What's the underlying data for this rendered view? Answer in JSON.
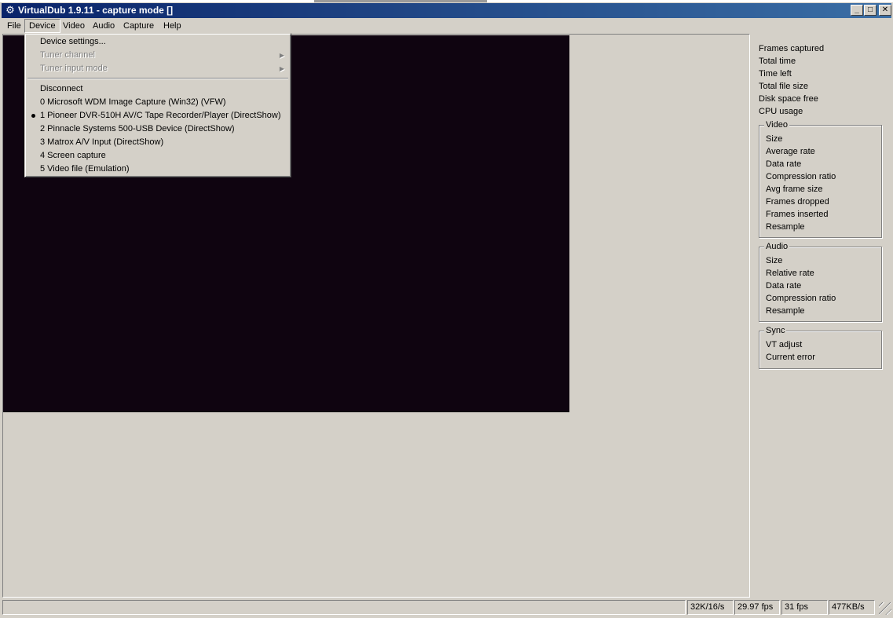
{
  "window": {
    "title": "VirtualDub 1.9.11 - capture mode []",
    "minimize_glyph": "_",
    "maximize_glyph": "□",
    "close_glyph": "✕"
  },
  "menubar": {
    "items": [
      {
        "label": "File"
      },
      {
        "label": "Device"
      },
      {
        "label": "Video"
      },
      {
        "label": "Audio"
      },
      {
        "label": "Capture"
      },
      {
        "label": "Help"
      }
    ]
  },
  "device_menu": {
    "items": [
      {
        "label": "Device settings...",
        "enabled": true
      },
      {
        "label": "Tuner channel",
        "enabled": false,
        "submenu": true
      },
      {
        "label": "Tuner input mode",
        "enabled": false,
        "submenu": true
      },
      {
        "label": "Disconnect",
        "enabled": true
      },
      {
        "label": "0 Microsoft WDM Image Capture (Win32) (VFW)",
        "enabled": true
      },
      {
        "label": "1 Pioneer DVR-510H AV/C Tape Recorder/Player (DirectShow)",
        "enabled": true,
        "selected": true
      },
      {
        "label": "2 Pinnacle Systems 500-USB Device (DirectShow)",
        "enabled": true
      },
      {
        "label": "3 Matrox A/V Input (DirectShow)",
        "enabled": true
      },
      {
        "label": "4 Screen capture",
        "enabled": true
      },
      {
        "label": "5 Video file (Emulation)",
        "enabled": true
      }
    ]
  },
  "info": {
    "top": [
      "Frames captured",
      "Total time",
      "Time left",
      "Total file size",
      "Disk space free",
      "CPU usage"
    ],
    "video": {
      "caption": "Video",
      "lines": [
        "Size",
        "Average rate",
        "Data rate",
        "Compression ratio",
        "Avg frame size",
        "Frames dropped",
        "Frames inserted",
        "Resample"
      ]
    },
    "audio": {
      "caption": "Audio",
      "lines": [
        "Size",
        "Relative rate",
        "Data rate",
        "Compression ratio",
        "Resample"
      ]
    },
    "sync": {
      "caption": "Sync",
      "lines": [
        "VT adjust",
        "Current error"
      ]
    }
  },
  "statusbar": {
    "audio_format": "32K/16/s",
    "target_fps": "29.97 fps",
    "actual_fps": "31 fps",
    "data_rate": "477KB/s"
  },
  "colors": {
    "preview_bg": "#0f0410",
    "title_gradient_start": "#0a246a",
    "title_gradient_end": "#3a6ea5",
    "face": "#d4d0c8"
  }
}
